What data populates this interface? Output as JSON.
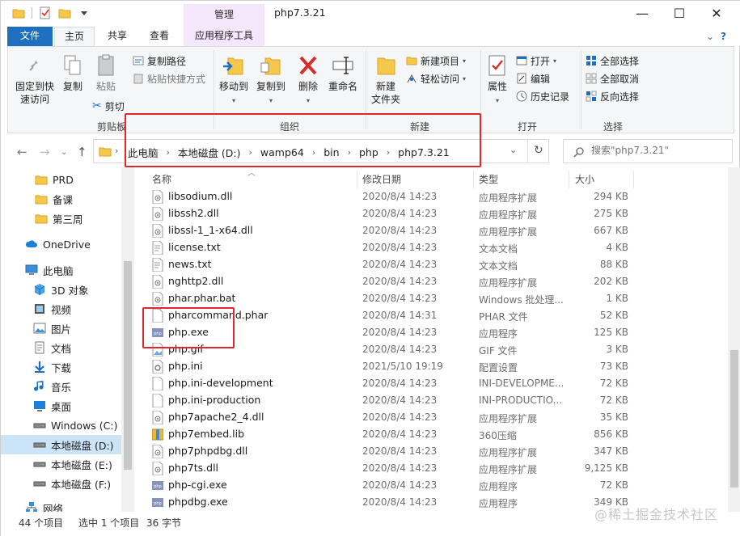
{
  "window": {
    "title": "php7.3.21",
    "context_tab": "管理",
    "min_glyph": "—",
    "max_glyph": "☐",
    "close_glyph": "✕"
  },
  "tabs": {
    "file": "文件",
    "home": "主页",
    "share": "共享",
    "view": "查看",
    "app_tools": "应用程序工具"
  },
  "ribbon": {
    "clipboard": {
      "pin": "固定到快速访问",
      "pin_line2": "速访问",
      "pin_line1": "固定到快",
      "copy": "复制",
      "paste": "粘贴",
      "copy_path": "复制路径",
      "paste_shortcut": "粘贴快捷方式",
      "cut": "剪切",
      "group": "剪贴板"
    },
    "organize": {
      "move_to": "移动到",
      "copy_to": "复制到",
      "delete": "删除",
      "rename": "重命名",
      "group": "组织"
    },
    "new": {
      "new_folder_line1": "新建",
      "new_folder_line2": "文件夹",
      "new_item": "新建项目",
      "easy_access": "轻松访问",
      "group": "新建"
    },
    "open": {
      "properties": "属性",
      "open": "打开",
      "edit": "编辑",
      "history": "历史记录",
      "group": "打开"
    },
    "select": {
      "select_all": "全部选择",
      "select_none": "全部取消",
      "invert": "反向选择",
      "group": "选择"
    }
  },
  "address": {
    "crumbs": [
      "此电脑",
      "本地磁盘 (D:)",
      "wamp64",
      "bin",
      "php",
      "php7.3.21"
    ],
    "search_placeholder": "搜索\"php7.3.21\""
  },
  "nav": {
    "items": [
      {
        "label": "PRD",
        "icon": "folder-icon"
      },
      {
        "label": "备课",
        "icon": "folder-icon"
      },
      {
        "label": "第三周",
        "icon": "folder-icon"
      },
      {
        "label": "OneDrive",
        "icon": "cloud-icon"
      },
      {
        "label": "此电脑",
        "icon": "computer-icon"
      },
      {
        "label": "3D 对象",
        "icon": "cube-icon"
      },
      {
        "label": "视频",
        "icon": "video-icon"
      },
      {
        "label": "图片",
        "icon": "picture-icon"
      },
      {
        "label": "文档",
        "icon": "document-icon"
      },
      {
        "label": "下载",
        "icon": "download-icon"
      },
      {
        "label": "音乐",
        "icon": "music-icon"
      },
      {
        "label": "桌面",
        "icon": "desktop-icon"
      },
      {
        "label": "Windows (C:)",
        "icon": "drive-icon"
      },
      {
        "label": "本地磁盘 (D:)",
        "icon": "drive-icon"
      },
      {
        "label": "本地磁盘 (E:)",
        "icon": "drive-icon"
      },
      {
        "label": "本地磁盘 (F:)",
        "icon": "drive-icon"
      },
      {
        "label": "网络",
        "icon": "network-icon"
      }
    ]
  },
  "columns": {
    "name": "名称",
    "date": "修改日期",
    "type": "类型",
    "size": "大小"
  },
  "files": [
    {
      "name": "libsodium.dll",
      "date": "2020/8/4 14:23",
      "type": "应用程序扩展",
      "size": "294 KB",
      "icon": "dll-icon"
    },
    {
      "name": "libssh2.dll",
      "date": "2020/8/4 14:23",
      "type": "应用程序扩展",
      "size": "275 KB",
      "icon": "dll-icon"
    },
    {
      "name": "libssl-1_1-x64.dll",
      "date": "2020/8/4 14:23",
      "type": "应用程序扩展",
      "size": "667 KB",
      "icon": "dll-icon"
    },
    {
      "name": "license.txt",
      "date": "2020/8/4 14:23",
      "type": "文本文档",
      "size": "4 KB",
      "icon": "text-file-icon"
    },
    {
      "name": "news.txt",
      "date": "2020/8/4 14:23",
      "type": "文本文档",
      "size": "88 KB",
      "icon": "text-file-icon"
    },
    {
      "name": "nghttp2.dll",
      "date": "2020/8/4 14:23",
      "type": "应用程序扩展",
      "size": "202 KB",
      "icon": "dll-icon"
    },
    {
      "name": "phar.phar.bat",
      "date": "2020/8/4 14:23",
      "type": "Windows 批处理...",
      "size": "1 KB",
      "icon": "batch-file-icon"
    },
    {
      "name": "pharcommand.phar",
      "date": "2020/8/4 14:31",
      "type": "PHAR 文件",
      "size": "52 KB",
      "icon": "blank-file-icon"
    },
    {
      "name": "php.exe",
      "date": "2020/8/4 14:23",
      "type": "应用程序",
      "size": "125 KB",
      "icon": "php-exe-icon"
    },
    {
      "name": "php.gif",
      "date": "2020/8/4 14:23",
      "type": "GIF 文件",
      "size": "3 KB",
      "icon": "image-file-icon"
    },
    {
      "name": "php.ini",
      "date": "2021/5/10 19:19",
      "type": "配置设置",
      "size": "73 KB",
      "icon": "settings-file-icon"
    },
    {
      "name": "php.ini-development",
      "date": "2020/8/4 14:23",
      "type": "INI-DEVELOPME...",
      "size": "72 KB",
      "icon": "blank-file-icon"
    },
    {
      "name": "php.ini-production",
      "date": "2020/8/4 14:23",
      "type": "INI-PRODUCTIO...",
      "size": "72 KB",
      "icon": "blank-file-icon"
    },
    {
      "name": "php7apache2_4.dll",
      "date": "2020/8/4 14:23",
      "type": "应用程序扩展",
      "size": "35 KB",
      "icon": "dll-icon"
    },
    {
      "name": "php7embed.lib",
      "date": "2020/8/4 14:23",
      "type": "360压缩",
      "size": "856 KB",
      "icon": "archive-icon"
    },
    {
      "name": "php7phpdbg.dll",
      "date": "2020/8/4 14:23",
      "type": "应用程序扩展",
      "size": "347 KB",
      "icon": "dll-icon"
    },
    {
      "name": "php7ts.dll",
      "date": "2020/8/4 14:23",
      "type": "应用程序扩展",
      "size": "9,125 KB",
      "icon": "dll-icon"
    },
    {
      "name": "php-cgi.exe",
      "date": "2020/8/4 14:23",
      "type": "应用程序",
      "size": "72 KB",
      "icon": "php-exe-icon"
    },
    {
      "name": "phpdbg.exe",
      "date": "2020/8/4 14:23",
      "type": "应用程序",
      "size": "349 KB",
      "icon": "php-exe-icon"
    }
  ],
  "status": {
    "count": "44 个项目",
    "selection": "选中 1 个项目",
    "sel_size": "36 字节"
  },
  "watermark": "@稀土掘金技术社区",
  "colors": {
    "accent": "#1e6fbf",
    "highlight_box": "#e0272b",
    "manage_tab_bg": "#f4e6fb",
    "nav_selected": "#cce4f7"
  }
}
